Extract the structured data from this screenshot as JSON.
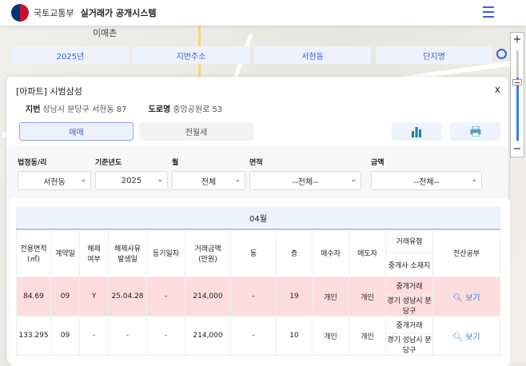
{
  "header": {
    "org": "국토교통부",
    "title": "실거래가 공개시스템"
  },
  "map": {
    "labels": [
      "이매촌"
    ]
  },
  "search": {
    "items": [
      "2025년",
      "지번주소",
      "서현동",
      "단지명"
    ]
  },
  "zoom": {
    "plus": "+",
    "minus": "−",
    "level": 0.7
  },
  "panel": {
    "title": "[아파트] 시범삼성",
    "close": "x",
    "jibun_label": "지번",
    "jibun": "성남시 분당구 서현동 87",
    "road_label": "도로명",
    "road": "중앙공원로 53",
    "tabs": [
      "매매",
      "전월세"
    ]
  },
  "filters": [
    {
      "label": "법정동/리",
      "value": "서현동"
    },
    {
      "label": "기준년도",
      "value": "2025"
    },
    {
      "label": "월",
      "value": "전체"
    },
    {
      "label": "면적",
      "value": "--전체--"
    },
    {
      "label": "금액",
      "value": "--전체--"
    }
  ],
  "table": {
    "month": "04월",
    "headers": [
      "전용면적\n(㎡)",
      "계약일",
      "해제\n여부",
      "해제사유\n발생일",
      "등기일자",
      "거래금액\n(만원)",
      "동",
      "층",
      "매수자",
      "매도자",
      "거래유형",
      "중개사 소재지",
      "전산공부"
    ],
    "rows": [
      {
        "area": "84.69",
        "day": "09",
        "cancel": "Y",
        "cancel_date": "25.04.28",
        "reg": "-",
        "price": "214,000",
        "dong": "-",
        "floor": "19",
        "buyer": "개인",
        "seller": "개인",
        "type": "중개거래",
        "agent": "경기 성남시 분당구",
        "view": "보기"
      },
      {
        "area": "133.295",
        "day": "09",
        "cancel": "-",
        "cancel_date": "-",
        "reg": "-",
        "price": "214,000",
        "dong": "-",
        "floor": "10",
        "buyer": "개인",
        "seller": "개인",
        "type": "중개거래",
        "agent": "경기 성남시 분당구",
        "view": "보기"
      }
    ]
  }
}
